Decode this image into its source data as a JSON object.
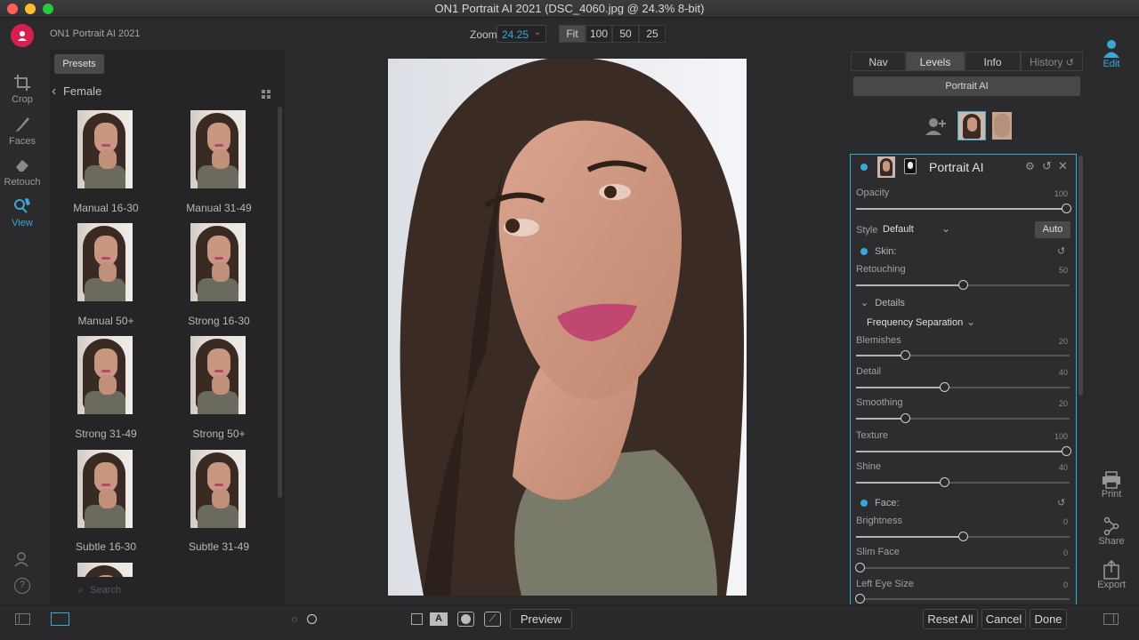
{
  "window": {
    "title": "ON1 Portrait AI 2021 (DSC_4060.jpg @ 24.3% 8-bit)"
  },
  "app": {
    "name": "ON1 Portrait AI 2021"
  },
  "zoom": {
    "label": "Zoom",
    "value": "24.25",
    "buttons": [
      "Fit",
      "100",
      "50",
      "25"
    ]
  },
  "left_tools": [
    {
      "label": "Crop",
      "icon": "crop-icon"
    },
    {
      "label": "Faces",
      "icon": "brush-icon"
    },
    {
      "label": "Retouch",
      "icon": "eraser-icon"
    },
    {
      "label": "View",
      "icon": "view-hand-icon"
    }
  ],
  "presets": {
    "tab": "Presets",
    "category": "Female",
    "items": [
      "Manual 16-30",
      "Manual 31-49",
      "Manual 50+",
      "Strong 16-30",
      "Strong 31-49",
      "Strong 50+",
      "Subtle 16-30",
      "Subtle 31-49"
    ],
    "search_placeholder": "Search"
  },
  "right_tabs": [
    "Nav",
    "Levels",
    "Info",
    "History"
  ],
  "portrait_ai_button": "Portrait AI",
  "module": {
    "title": "Portrait AI",
    "opacity": {
      "label": "Opacity",
      "value": "100",
      "fraction": 1.0
    },
    "style": {
      "label": "Style",
      "value": "Default",
      "auto": "Auto"
    },
    "skin": {
      "header": "Skin:",
      "retouching": {
        "label": "Retouching",
        "value": "50",
        "fraction": 0.5
      },
      "details_label": "Details",
      "method": "Frequency Separation",
      "blemishes": {
        "label": "Blemishes",
        "value": "20",
        "fraction": 0.22
      },
      "detail": {
        "label": "Detail",
        "value": "40",
        "fraction": 0.41
      },
      "smoothing": {
        "label": "Smoothing",
        "value": "20",
        "fraction": 0.22
      },
      "texture": {
        "label": "Texture",
        "value": "100",
        "fraction": 1.0
      },
      "shine": {
        "label": "Shine",
        "value": "40",
        "fraction": 0.41
      }
    },
    "face": {
      "header": "Face:",
      "brightness": {
        "label": "Brightness",
        "value": "0",
        "fraction": 0.5
      },
      "slim_face": {
        "label": "Slim Face",
        "value": "0",
        "fraction": 0.0
      },
      "left_eye_size": {
        "label": "Left Eye Size",
        "value": "0",
        "fraction": 0.0
      }
    }
  },
  "right_tools": [
    {
      "label": "Edit",
      "icon": "person-icon"
    },
    {
      "label": "Print",
      "icon": "printer-icon"
    },
    {
      "label": "Share",
      "icon": "share-icon"
    },
    {
      "label": "Export",
      "icon": "export-icon"
    }
  ],
  "bottom": {
    "preview": "Preview",
    "reset_all": "Reset All",
    "cancel": "Cancel",
    "done": "Done"
  },
  "colors": {
    "accent": "#3aa7d9",
    "logo": "#d82050",
    "background": "#2a2a2c"
  }
}
